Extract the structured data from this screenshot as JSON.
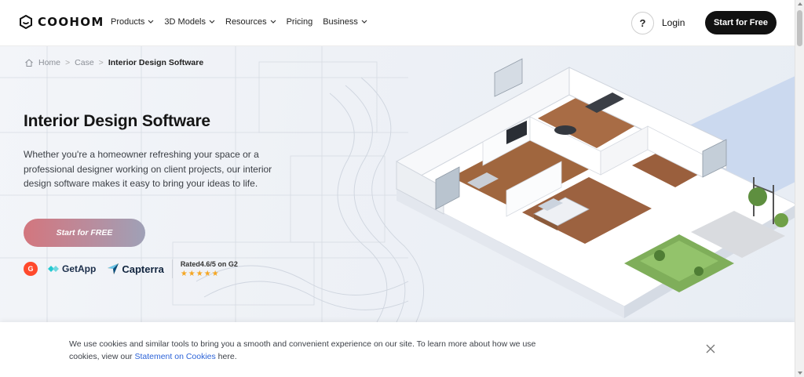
{
  "header": {
    "logo_text": "COOHOM",
    "nav": [
      {
        "label": "Products",
        "has_dropdown": true
      },
      {
        "label": "3D Models",
        "has_dropdown": true
      },
      {
        "label": "Resources",
        "has_dropdown": true
      },
      {
        "label": "Pricing",
        "has_dropdown": false
      },
      {
        "label": "Business",
        "has_dropdown": true
      }
    ],
    "help_label": "?",
    "login_label": "Login",
    "start_label": "Start for Free"
  },
  "breadcrumb": {
    "home": "Home",
    "sep": ">",
    "case": "Case",
    "current": "Interior Design Software"
  },
  "hero": {
    "title": "Interior Design Software",
    "description": "Whether you're a homeowner refreshing your space or a professional designer working on client projects, our interior design software makes it easy to bring your ideas to life.",
    "cta_label": "Start for FREE"
  },
  "badges": {
    "g2": "G",
    "getapp": "GetApp",
    "capterra": "Capterra",
    "rating_text": "Rated4.6/5 on G2",
    "stars": "★★★★★"
  },
  "cookie": {
    "text_before": "We use cookies and similar tools to bring you a smooth and convenient experience on our site. To learn more about how we use cookies, view our ",
    "link_text": "Statement on Cookies",
    "text_after": " here."
  },
  "colors": {
    "primary_dark": "#111111",
    "cta_gradient_start": "#d3767e",
    "cta_gradient_end": "#9fa1b7",
    "link": "#2c63d8",
    "g2_red": "#ff492c",
    "star": "#f5a623"
  }
}
